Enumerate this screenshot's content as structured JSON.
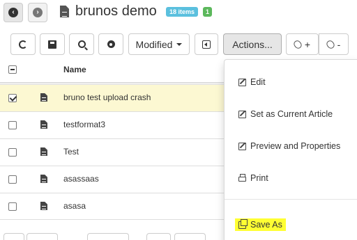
{
  "header": {
    "title": "brunos demo",
    "items_badge": "18 items",
    "count_badge": "1"
  },
  "toolbar": {
    "modified_label": "Modified",
    "actions_label": "Actions...",
    "attach_add_label": "+",
    "attach_remove_label": "-"
  },
  "table": {
    "column_name": "Name",
    "rows": [
      {
        "name": "bruno test upload crash",
        "checked": true
      },
      {
        "name": "testformat3",
        "checked": false
      },
      {
        "name": "Test",
        "checked": false
      },
      {
        "name": "asassaas",
        "checked": false
      },
      {
        "name": "asasa",
        "checked": false
      }
    ]
  },
  "actions_menu": {
    "items": [
      {
        "label": "Edit",
        "icon": "pencil-icon"
      },
      {
        "label": "Set as Current Article",
        "icon": "pencil-icon"
      },
      {
        "label": "Preview and Properties",
        "icon": "pencil-icon"
      },
      {
        "label": "Print",
        "icon": "print-icon"
      },
      {
        "label": "Save As",
        "icon": "copy-icon"
      }
    ]
  },
  "colors": {
    "selected_row": "#fcf8d2",
    "highlight": "#ffff33",
    "info_badge": "#5bc0de",
    "success_badge": "#5cb85c"
  }
}
